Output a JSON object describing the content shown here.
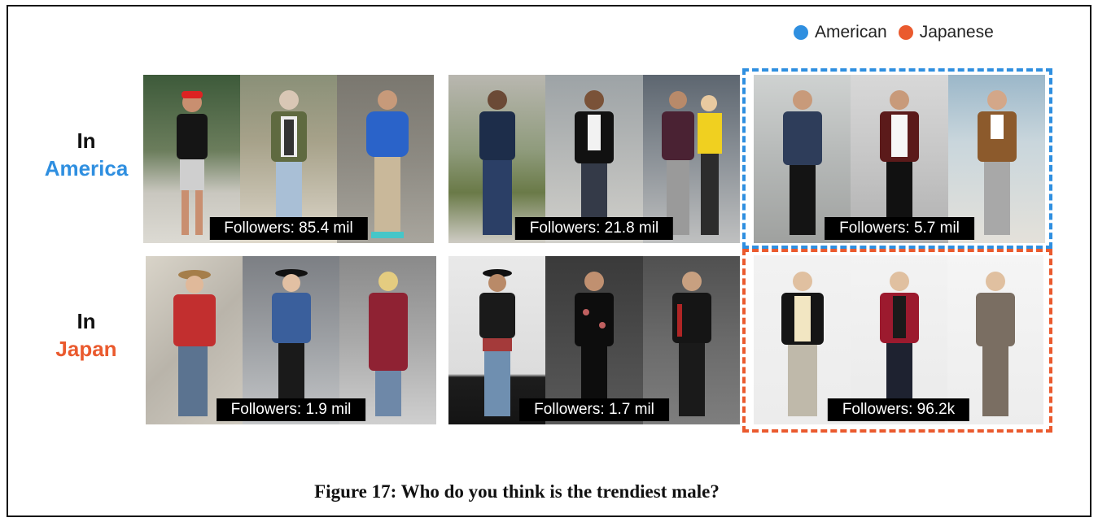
{
  "legend": [
    {
      "label": "American",
      "color": "#2f8fe0"
    },
    {
      "label": "Japanese",
      "color": "#ea5a2e"
    }
  ],
  "rows": [
    {
      "line1": "In",
      "line2": "America",
      "color": "#2f8fe0"
    },
    {
      "line1": "In",
      "line2": "Japan",
      "color": "#ea5a2e"
    }
  ],
  "groups": [
    {
      "followers": "Followers: 85.4 mil"
    },
    {
      "followers": "Followers: 21.8 mil"
    },
    {
      "followers": "Followers: 5.7 mil"
    },
    {
      "followers": "Followers: 1.9 mil"
    },
    {
      "followers": "Followers: 1.7 mil"
    },
    {
      "followers": "Followers: 96.2k"
    }
  ],
  "caption": "Figure 17: Who do you think is the trendiest male?"
}
